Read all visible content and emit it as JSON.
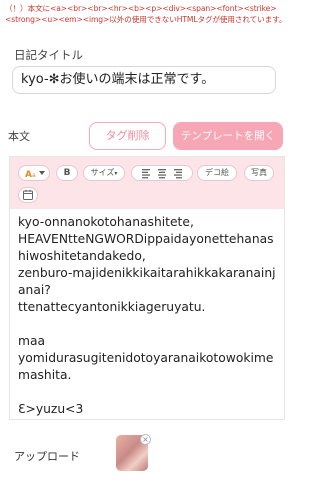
{
  "warning": "（！）本文に<a><br><br><hr><b><p><div><span><font><strike><strong><u><em><img>以外の使用できないHTMLタグが使用されています。",
  "diary": {
    "title_label": "日記タイトル",
    "title_value": "kyo-✻お使いの端末は正常です。",
    "body_label": "本文",
    "delete_tag_label": "タグ削除",
    "open_template_label": "テンプレートを開く"
  },
  "toolbar": {
    "bold": "B",
    "size": "サイズ",
    "deco": "デコ絵",
    "photo": "写真"
  },
  "body_text": "kyo-onnanokotohanashitete,\nHEAVENtteNGWORDippaidayonettehanashiwoshitetandakedo,\nzenburo-majidenikkikaitarahikkakaranainjanai?\nttenattecyantonikkiageruyatu.\n\nmaa\nyomidurasugitenidotoyaranaikotowokimemashita.\n\nƐ>yuzu<3",
  "upload": {
    "label": "アップロード"
  },
  "colors": {
    "warning": "#d0342c",
    "accent_pink": "#f6a6b4",
    "toolbar_bg": "#fde4e8"
  }
}
